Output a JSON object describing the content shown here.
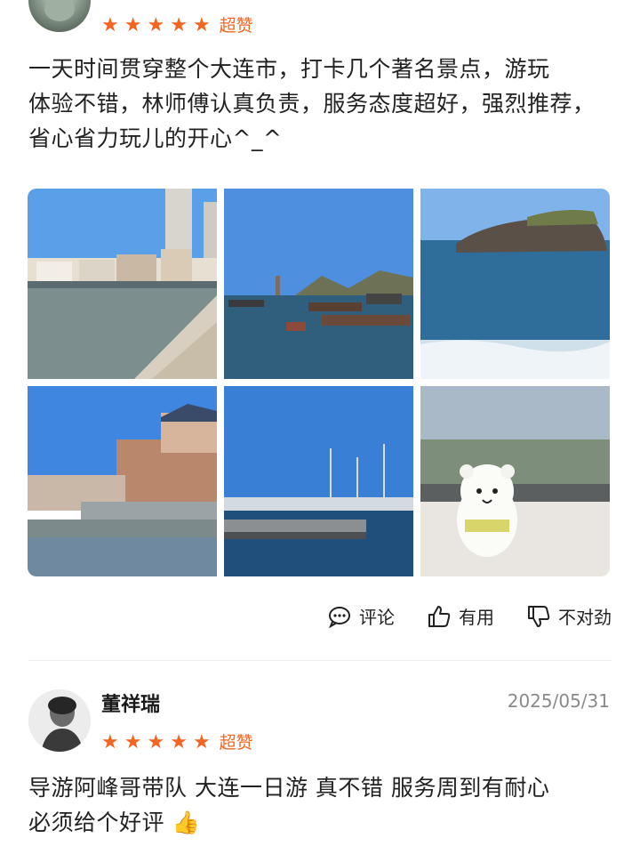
{
  "review1": {
    "rating_label": "超赞",
    "text_lines": [
      "一天时间贯穿整个大连市，打卡几个著名景点，游玩",
      "体验不错，林师傅认真负责，服务态度超好，强烈推荐，",
      "省心省力玩儿的开心^_^"
    ],
    "rating": 5,
    "photos": [
      "harbor-buildings",
      "fishing-boats",
      "rocky-island",
      "european-buildings",
      "marina-yachts",
      "bear-plush-view"
    ]
  },
  "actions": {
    "comment": "评论",
    "useful": "有用",
    "not_right": "不对劲"
  },
  "review2": {
    "username": "董祥瑞",
    "date": "2025/05/31",
    "rating": 5,
    "rating_label": "超赞",
    "text_lines": [
      "导游阿峰哥带队 大连一日游 真不错 服务周到有耐心",
      "必须给个好评 👍"
    ]
  },
  "colors": {
    "accent": "#f26522",
    "muted": "#8a8a8a"
  }
}
